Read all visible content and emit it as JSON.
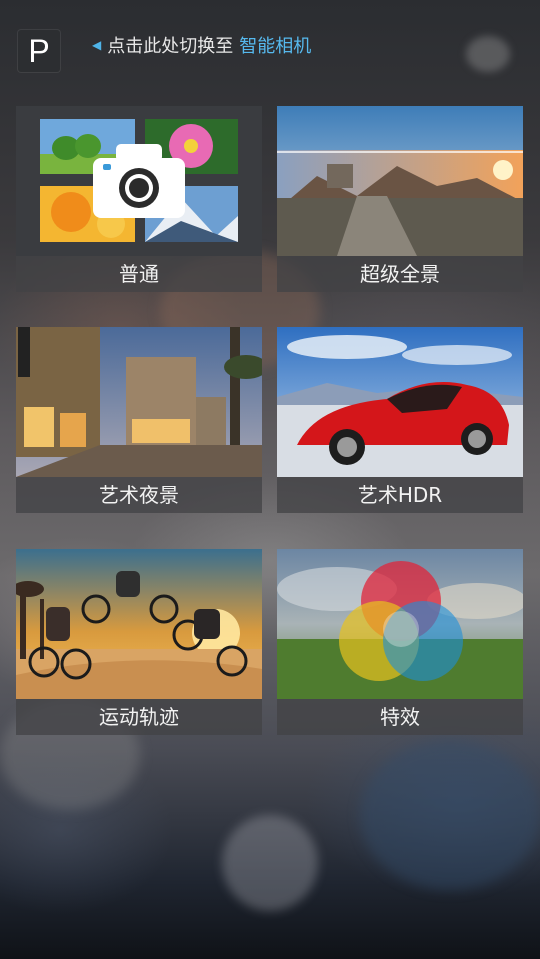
{
  "header": {
    "mode_badge": "P",
    "hint_prefix": "点击此处切换至",
    "hint_target": "智能相机"
  },
  "modes": [
    {
      "label": "普通"
    },
    {
      "label": "超级全景"
    },
    {
      "label": "艺术夜景"
    },
    {
      "label": "艺术HDR"
    },
    {
      "label": "运动轨迹"
    },
    {
      "label": "特效"
    }
  ],
  "colors": {
    "accent": "#56b9ee",
    "text": "#f2f2f2"
  },
  "icons": {
    "hint_arrow": "triangle-left-icon",
    "normal_mode": "camera-icon"
  }
}
